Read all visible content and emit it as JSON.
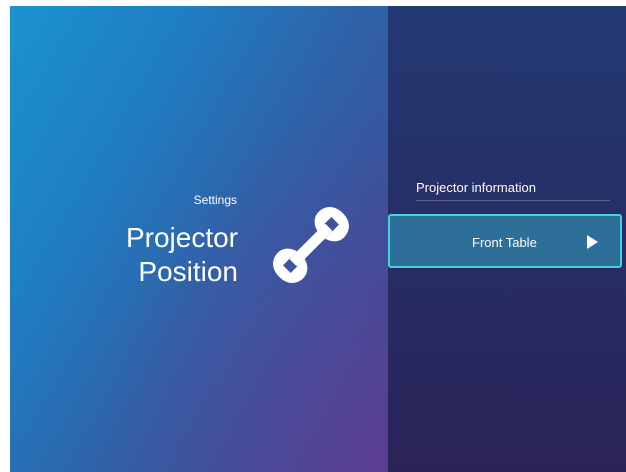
{
  "left": {
    "section_label": "Settings",
    "title_line1": "Projector",
    "title_line2": "Position",
    "icon": "wrench-icon"
  },
  "right": {
    "info_label": "Projector information",
    "option_value": "Front Table",
    "option_icon": "play-arrow-icon"
  },
  "colors": {
    "accent_border": "#40d3e0",
    "selected_bg": "#2d6f99",
    "left_gradient_start": "#1a93cf",
    "right_bg": "#262f66"
  }
}
